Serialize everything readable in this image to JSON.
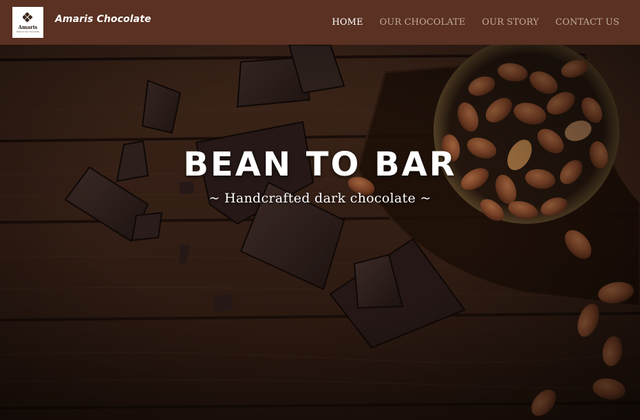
{
  "site": {
    "logo": {
      "word": "Amaris",
      "tagline": "bean to bar chocolate",
      "icon": "diamond-cacao-icon"
    },
    "brand_name": "Amaris Chocolate"
  },
  "nav": {
    "items": [
      {
        "label": "HOME",
        "active": true
      },
      {
        "label": "OUR CHOCOLATE",
        "active": false
      },
      {
        "label": "OUR STORY",
        "active": false
      },
      {
        "label": "CONTACT US",
        "active": false
      }
    ]
  },
  "hero": {
    "title": "BEAN TO BAR",
    "subtitle": "~ Handcrafted dark chocolate ~"
  },
  "colors": {
    "navbar": "#5a3122",
    "nav_text": "#c2aa9e",
    "nav_active": "#ffffff",
    "wood": "#3d2418",
    "chocolate": "#2b1c17",
    "cacao_bean": "#9a5533"
  }
}
